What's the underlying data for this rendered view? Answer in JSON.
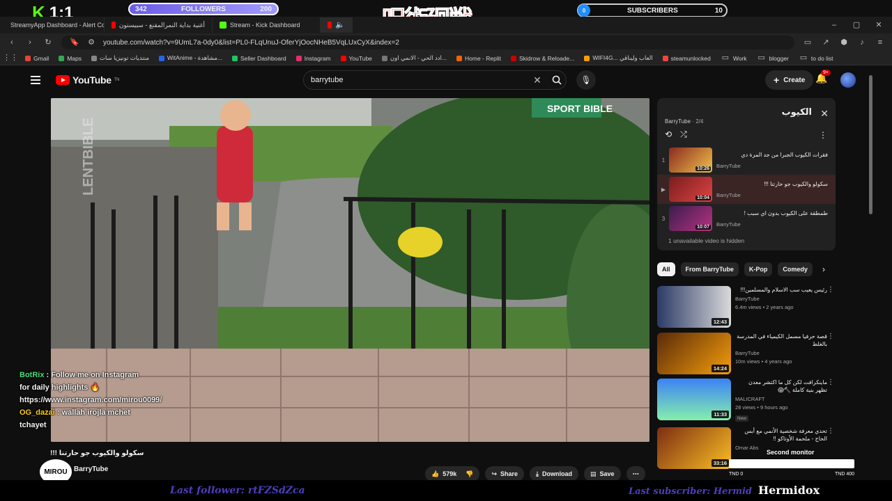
{
  "overlay": {
    "score": "1:1",
    "followers_label": "FOLLOWERS",
    "followers_current": "342",
    "followers_goal": "200",
    "subscribers_label": "SUBSCRIBERS",
    "subscribers_current": "0",
    "subscribers_goal": "10",
    "kanji": "呪術廻戦",
    "chat": [
      {
        "user": "BotRix",
        "message": ": Follow me on Instagram for daily highlights 🔥 https://www.instagram.com/mirou0099/"
      },
      {
        "user": "OG_dazai",
        "message": ": wallah irojla mchet tchayet"
      }
    ],
    "last_follower": "Last follower: rtFZSdZca",
    "last_subscriber": "Last subscriber: Hermid",
    "streamer": "Hermidox",
    "mirou_logo": "MIROU",
    "second_monitor": "Second monitor",
    "second_monitor_left": "TND 0",
    "second_monitor_right": "TND 400"
  },
  "browser": {
    "tabs": [
      {
        "label": "StreamyApp Dashboard - Alert Conf",
        "color": "#3b82f6"
      },
      {
        "label": "أغنية بداية النمرالمقنع - سبيستون",
        "color": "#ff0000"
      },
      {
        "label": "Stream - Kick Dashboard",
        "color": "#53fc18"
      },
      {
        "label": "",
        "color": "#ff0000"
      }
    ],
    "url": "youtube.com/watch?v=9UmL7a-0dy0&list=PL0-FLqUnuJ-OferYjOocNHeB5VqLUxCyX&index=2",
    "bookmarks": [
      {
        "label": "Gmail",
        "color": "#ea4335"
      },
      {
        "label": "Maps",
        "color": "#34a853"
      },
      {
        "label": "منتديات تونيزيا سات",
        "color": "#888888"
      },
      {
        "label": "WitAnime - مشاهدة...",
        "color": "#2563eb"
      },
      {
        "label": "Seller Dashboard",
        "color": "#22c55e"
      },
      {
        "label": "Instagram",
        "color": "#e1306c"
      },
      {
        "label": "YouTube",
        "color": "#ff0000"
      },
      {
        "label": "ادد الحي - الانمي اون...",
        "color": "#777777"
      },
      {
        "label": "Home - Replit",
        "color": "#f26207"
      },
      {
        "label": "Skidrow & Reloade...",
        "color": "#cc0000"
      },
      {
        "label": "WIFI4G... العاب وليناقي",
        "color": "#f59e0b"
      },
      {
        "label": "steamunlocked",
        "color": "#ef4444"
      },
      {
        "label": "Work",
        "color": "#9ca3af"
      },
      {
        "label": "blogger",
        "color": "#9ca3af"
      },
      {
        "label": "to do list",
        "color": "#9ca3af"
      }
    ]
  },
  "youtube": {
    "logo": "YouTube",
    "logo_sup": "TN",
    "search_value": "barrytube",
    "create_label": "Create",
    "notif_count": "9+",
    "playlist": {
      "title": "الكيوب",
      "channel": "BarryTube",
      "position": "2/4",
      "items": [
        {
          "index": "1",
          "title": "فقرات الكيوب الجبرا من جد المرة دي",
          "channel": "BarryTube",
          "duration": "10:26",
          "c1": "#8b2a1f",
          "c2": "#f0c14b"
        },
        {
          "index": "▶",
          "title": "سكولو والكيوب جو حارتنا !!!",
          "channel": "BarryTube",
          "duration": "10:04",
          "c1": "#7a1d1d",
          "c2": "#d44"
        },
        {
          "index": "3",
          "title": "طمطقة على الكيوب بدون اي سبب !",
          "channel": "BarryTube",
          "duration": "10:07",
          "c1": "#3a1d4f",
          "c2": "#b83280"
        }
      ],
      "hidden_note": "1 unavailable video is hidden"
    },
    "chips": [
      "All",
      "From BarryTube",
      "K-Pop",
      "Comedy"
    ],
    "recommendations": [
      {
        "title": "رئيس يعيب سب الاسلام والمسلمين!!!",
        "channel": "BarryTube",
        "views": "6.4m views • 2 years ago",
        "duration": "12:43",
        "c1": "#2b3a67",
        "c2": "#d9d9d9",
        "new": ""
      },
      {
        "title": "قصة حرفيا مسمل الكيمياء في المدرسة بالغلط",
        "channel": "BarryTube",
        "views": "10m views • 4 years ago",
        "duration": "14:24",
        "c1": "#5a2a0a",
        "c2": "#f59e0b",
        "new": ""
      },
      {
        "title": "ماينكرافت لكن كل ما اكتشر معدن تظهر بنية كاملة 🔨😱",
        "channel": "MALICRAFT",
        "views": "28 views • 9 hours ago",
        "duration": "11:33",
        "c1": "#3b82f6",
        "c2": "#86efac",
        "new": "New"
      },
      {
        "title": "تحدي معرفة شخصية الأنمي مع أبس الحاج - ملحمة الأوتاكو !!",
        "channel": "Omar Abs",
        "views": "",
        "duration": "33:16",
        "c1": "#7c2d12",
        "c2": "#fbbf24",
        "new": ""
      }
    ],
    "video": {
      "title": "سكولو والكيوب جو حارتنا !!!",
      "channel": "BarryTube",
      "likes": "579k",
      "share": "Share",
      "download": "Download",
      "save": "Save",
      "watermark_left": "LENTBIBLE",
      "watermark_sign": "SPORT BIBLE"
    }
  }
}
